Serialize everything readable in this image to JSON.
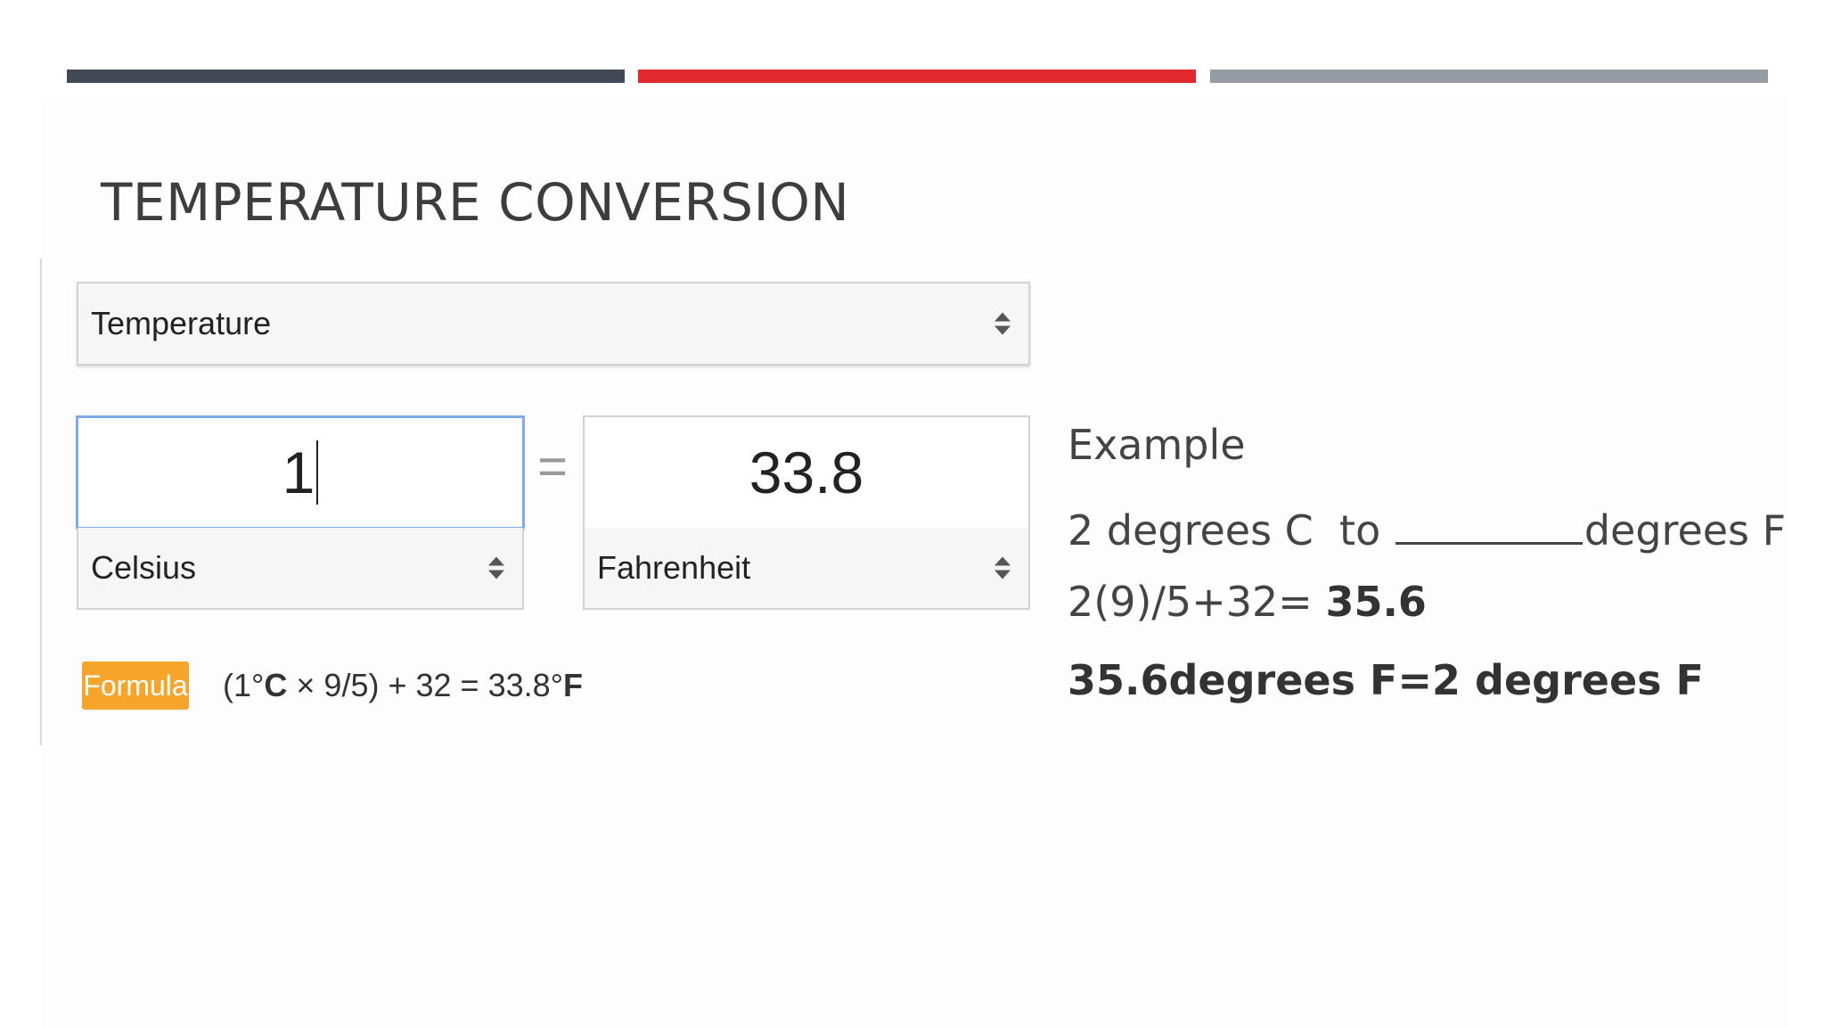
{
  "slide": {
    "title": "TEMPERATURE CONVERSION"
  },
  "converter": {
    "category": "Temperature",
    "from_value": "1",
    "to_value": "33.8",
    "equals": "=",
    "from_unit": "Celsius",
    "to_unit": "Fahrenheit",
    "formula_badge": "Formula",
    "formula_prefix": "(1°",
    "formula_unit_c": "C",
    "formula_middle": " × 9/5) + 32 = 33.8°",
    "formula_unit_f": "F"
  },
  "example": {
    "heading": "Example",
    "q_prefix": "2 degrees C  to ",
    "q_suffix": "degrees F",
    "calc_prefix": "2(9)/5+32= ",
    "calc_result": "35.6",
    "answer": "35.6degrees F=2 degrees F"
  },
  "colors": {
    "bar_dark": "#414a54",
    "bar_red": "#e2282f",
    "bar_gray": "#969ca4",
    "formula_badge": "#f5a52a",
    "input_focus": "#7eaaea"
  },
  "icons": {
    "select_arrows": "up-down-arrows-icon"
  }
}
